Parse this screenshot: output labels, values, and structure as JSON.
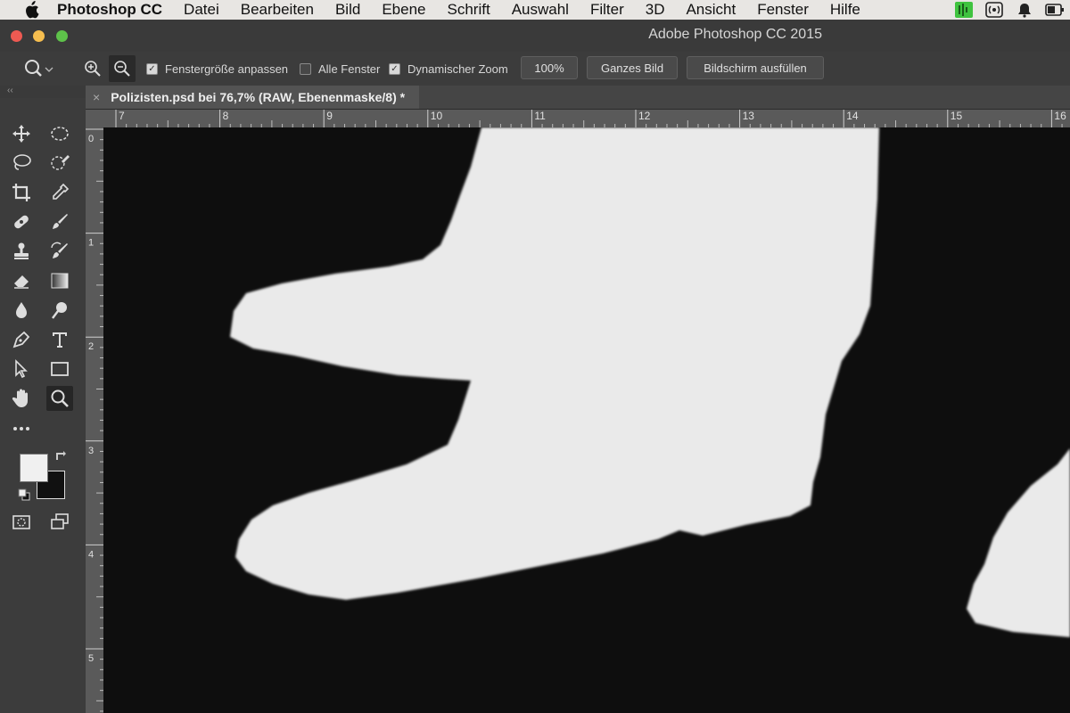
{
  "menubar": {
    "app_name": "Photoshop CC",
    "items": [
      "Datei",
      "Bearbeiten",
      "Bild",
      "Ebene",
      "Schrift",
      "Auswahl",
      "Filter",
      "3D",
      "Ansicht",
      "Fenster",
      "Hilfe"
    ]
  },
  "window": {
    "title": "Adobe Photoshop CC 2015"
  },
  "options": {
    "resize_windows_label": "Fenstergröße anpassen",
    "resize_windows_checked": true,
    "all_windows_label": "Alle Fenster",
    "all_windows_checked": false,
    "scrubby_zoom_label": "Dynamischer Zoom",
    "scrubby_zoom_checked": true,
    "zoom_value": "100%",
    "fit_screen_label": "Ganzes Bild",
    "fill_screen_label": "Bildschirm ausfüllen"
  },
  "document": {
    "tab_close": "×",
    "tab_title": "Polizisten.psd bei 76,7% (RAW, Ebenenmaske/8) *"
  },
  "ruler": {
    "horizontal": [
      "7",
      "8",
      "9",
      "10",
      "11",
      "12",
      "13",
      "14",
      "15",
      "16"
    ],
    "vertical": [
      "0",
      "1",
      "2",
      "3",
      "4",
      "5"
    ]
  },
  "colors": {
    "foreground": "#f0f0f0",
    "background": "#111111",
    "mask_white": "#eaeaea",
    "mask_black": "#0e0e0e",
    "traffic_close": "#ee5a52",
    "traffic_min": "#f6be4f",
    "traffic_max": "#5ec24a"
  }
}
